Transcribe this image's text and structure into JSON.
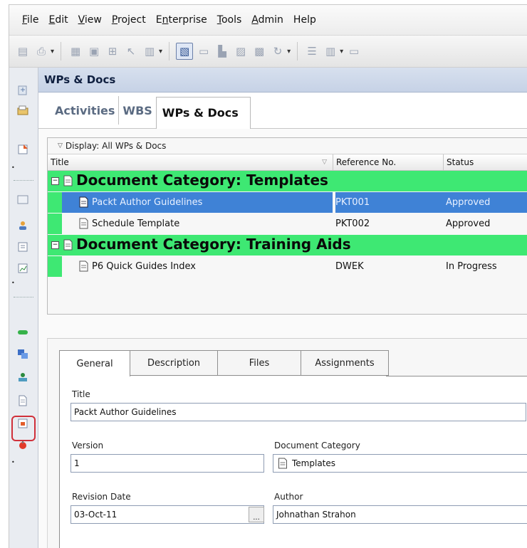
{
  "menu": [
    {
      "pre": "",
      "u": "F",
      "post": "ile"
    },
    {
      "pre": "",
      "u": "E",
      "post": "dit"
    },
    {
      "pre": "",
      "u": "V",
      "post": "iew"
    },
    {
      "pre": "",
      "u": "P",
      "post": "roject"
    },
    {
      "pre": "E",
      "u": "n",
      "post": "terprise"
    },
    {
      "pre": "",
      "u": "T",
      "post": "ools"
    },
    {
      "pre": "",
      "u": "A",
      "post": "dmin"
    },
    {
      "pre": "",
      "u": "",
      "post": "Help"
    }
  ],
  "panel": {
    "title": "WPs & Docs"
  },
  "view_tabs": [
    "Activities",
    "WBS",
    "WPs & Docs"
  ],
  "grid": {
    "display_label": "Display: All WPs & Docs",
    "columns": {
      "title": "Title",
      "ref": "Reference No.",
      "status": "Status"
    },
    "categories": [
      {
        "label": "Document Category: Templates"
      },
      {
        "label": "Document Category: Training Aids"
      }
    ],
    "rows": [
      {
        "title": "Packt Author Guidelines",
        "ref": "PKT001",
        "status": "Approved"
      },
      {
        "title": "Schedule Template",
        "ref": "PKT002",
        "status": "Approved"
      },
      {
        "title": "P6 Quick Guides Index",
        "ref": "DWEK",
        "status": "In Progress"
      }
    ]
  },
  "detail_tabs": [
    "General",
    "Description",
    "Files",
    "Assignments"
  ],
  "form": {
    "title_label": "Title",
    "title_value": "Packt Author Guidelines",
    "version_label": "Version",
    "version_value": "1",
    "category_label": "Document Category",
    "category_value": "Templates",
    "revision_label": "Revision Date",
    "revision_value": "03-Oct-11",
    "author_label": "Author",
    "author_value": "Johnathan Strahon",
    "ellipsis": "..."
  },
  "colors": {
    "category_green": "#3ee873",
    "selection_blue": "#3f82d6",
    "highlight_red": "#d0303a"
  }
}
